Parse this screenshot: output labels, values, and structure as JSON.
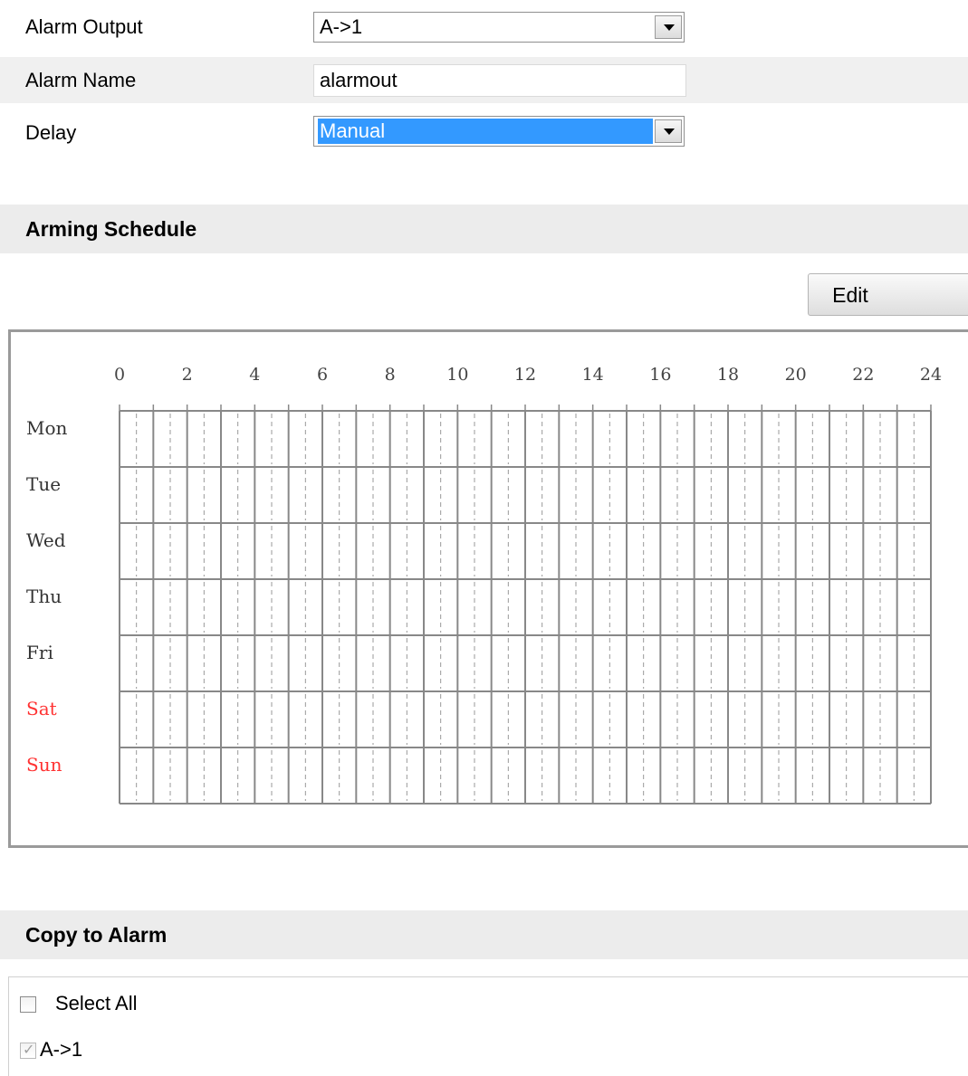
{
  "form": {
    "alarm_output": {
      "label": "Alarm Output",
      "value": "A->1"
    },
    "alarm_name": {
      "label": "Alarm Name",
      "value": "alarmout"
    },
    "delay": {
      "label": "Delay",
      "value": "Manual"
    }
  },
  "arming_schedule": {
    "title": "Arming Schedule",
    "edit_label": "Edit",
    "hour_labels": [
      "0",
      "2",
      "4",
      "6",
      "8",
      "10",
      "12",
      "14",
      "16",
      "18",
      "20",
      "22",
      "24"
    ],
    "days": [
      {
        "label": "Mon",
        "weekend": false
      },
      {
        "label": "Tue",
        "weekend": false
      },
      {
        "label": "Wed",
        "weekend": false
      },
      {
        "label": "Thu",
        "weekend": false
      },
      {
        "label": "Fri",
        "weekend": false
      },
      {
        "label": "Sat",
        "weekend": true
      },
      {
        "label": "Sun",
        "weekend": true
      }
    ],
    "colors": {
      "weekday_text": "#333333",
      "weekend_text": "#ff3333",
      "grid": "#888888"
    }
  },
  "copy_to_alarm": {
    "title": "Copy to Alarm",
    "select_all_label": "Select All",
    "select_all_checked": false,
    "items": [
      {
        "label": "A->1",
        "checked": true,
        "disabled": true
      }
    ]
  }
}
